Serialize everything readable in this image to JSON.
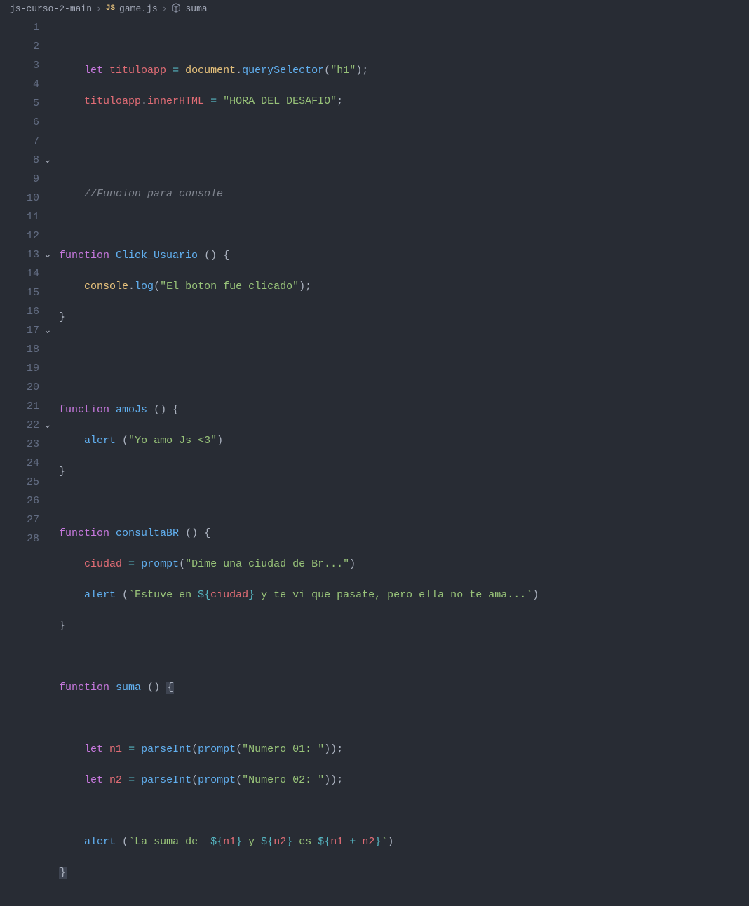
{
  "breadcrumb": {
    "folder": "js-curso-2-main",
    "file": "game.js",
    "symbol": "suma",
    "sep": "›"
  },
  "lines": {
    "max": 28,
    "folds": {
      "8": "⌄",
      "13": "⌄",
      "17": "⌄",
      "22": "⌄"
    }
  },
  "code": {
    "l1": "",
    "l2_let": "let",
    "l2_var": "tituloapp",
    "l2_eq": "=",
    "l2_doc": "document",
    "l2_dot": ".",
    "l2_qs": "querySelector",
    "l2_p1": "(",
    "l2_str": "\"h1\"",
    "l2_p2": ")",
    "l2_sc": ";",
    "l3_var": "tituloapp",
    "l3_dot": ".",
    "l3_prop": "innerHTML",
    "l3_eq": "=",
    "l3_str": "\"HORA DEL DESAFIO\"",
    "l3_sc": ";",
    "l6_comment": "//Funcion para console",
    "l8_fn": "function",
    "l8_name": "Click_Usuario",
    "l8_pp": "()",
    "l8_br": "{",
    "l9_con": "console",
    "l9_dot": ".",
    "l9_log": "log",
    "l9_p1": "(",
    "l9_str": "\"El boton fue clicado\"",
    "l9_p2": ")",
    "l9_sc": ";",
    "l10_br": "}",
    "l13_fn": "function",
    "l13_name": "amoJs",
    "l13_pp": "()",
    "l13_br": "{",
    "l14_alert": "alert",
    "l14_p1": "(",
    "l14_str": "\"Yo amo Js <3\"",
    "l14_p2": ")",
    "l15_br": "}",
    "l17_fn": "function",
    "l17_name": "consultaBR",
    "l17_pp": "()",
    "l17_br": "{",
    "l18_var": "ciudad",
    "l18_eq": "=",
    "l18_prompt": "prompt",
    "l18_p1": "(",
    "l18_str": "\"Dime una ciudad de Br...\"",
    "l18_p2": ")",
    "l19_alert": "alert",
    "l19_p1": "(",
    "l19_bt": "`",
    "l19_s1": "Estuve en ",
    "l19_ob": "${",
    "l19_v1": "ciudad",
    "l19_cb": "}",
    "l19_s2": " y te vi que pasate, pero ella no te ama...",
    "l19_p2": ")",
    "l20_br": "}",
    "l22_fn": "function",
    "l22_name": "suma",
    "l22_pp": "()",
    "l22_br": "{",
    "l24_let": "let",
    "l24_var": "n1",
    "l24_eq": "=",
    "l24_pi": "parseInt",
    "l24_p1": "(",
    "l24_prompt": "prompt",
    "l24_p2": "(",
    "l24_str": "\"Numero 01: \"",
    "l24_p3": "))",
    "l24_sc": ";",
    "l25_let": "let",
    "l25_var": "n2",
    "l25_eq": "=",
    "l25_pi": "parseInt",
    "l25_p1": "(",
    "l25_prompt": "prompt",
    "l25_p2": "(",
    "l25_str": "\"Numero 02: \"",
    "l25_p3": "))",
    "l25_sc": ";",
    "l27_alert": "alert",
    "l27_p1": "(",
    "l27_bt": "`",
    "l27_s1": "La suma de  ",
    "l27_ob": "${",
    "l27_v1": "n1",
    "l27_cb": "}",
    "l27_s2": " y ",
    "l27_v2": "n2",
    "l27_s3": " es ",
    "l27_v3a": "n1",
    "l27_plus": "+",
    "l27_v3b": "n2",
    "l27_p2": ")",
    "l28_br": "}"
  }
}
